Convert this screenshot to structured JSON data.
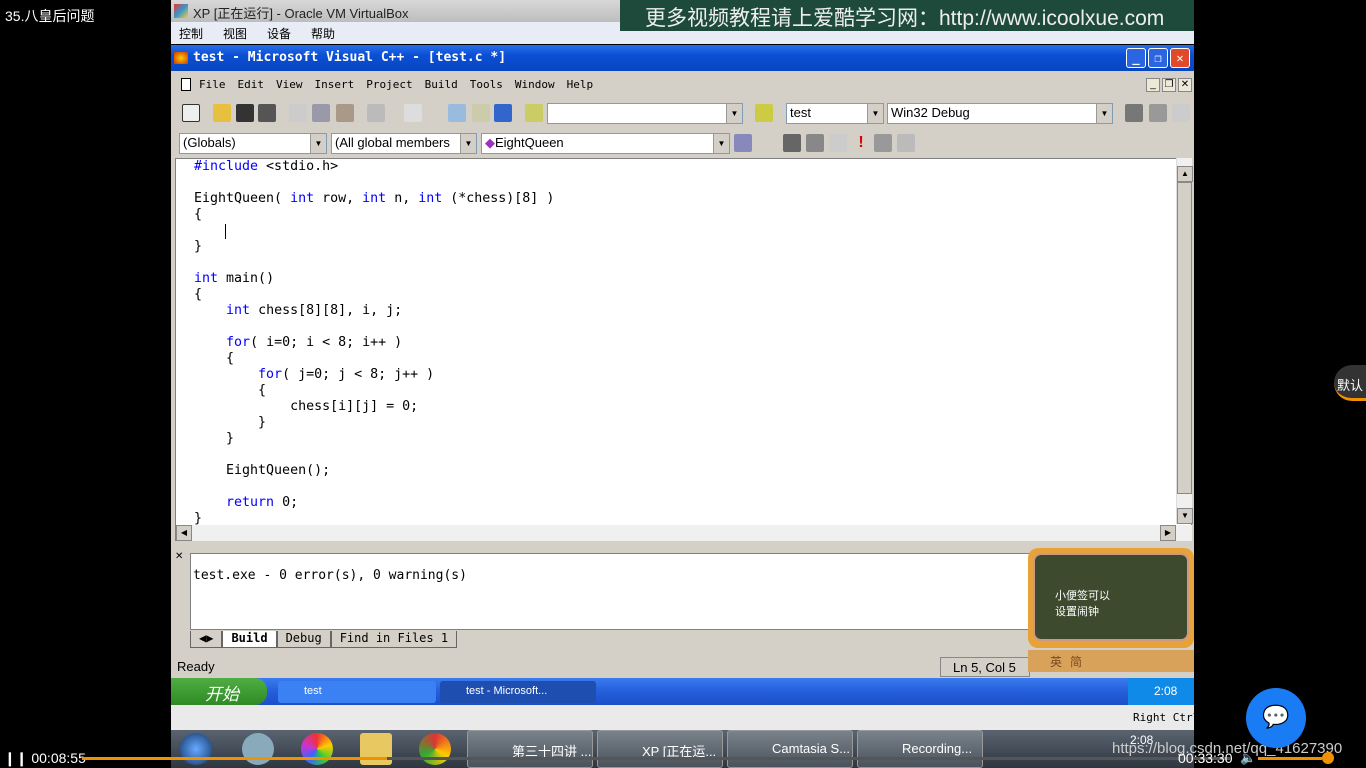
{
  "video": {
    "title": "35.八皇后问题",
    "current_time": "00:08:55",
    "total_time": "00:33:30",
    "progress": 0.266,
    "volume": 0.8,
    "url_watermark": "https://blog.csdn.net/qq_41627390",
    "default_label": "默认",
    "accent": "#f29100"
  },
  "vbox": {
    "title": "XP [正在运行] - Oracle VM VirtualBox",
    "menu": [
      "控制",
      "视图",
      "设备",
      "帮助"
    ],
    "right_ctrl": "Right Ctrl"
  },
  "watermark": "更多视频教程请上爱酷学习网：http://www.icoolxue.com",
  "vc": {
    "title": "test - Microsoft Visual C++ - [test.c *]",
    "menu": [
      "File",
      "Edit",
      "View",
      "Insert",
      "Project",
      "Build",
      "Tools",
      "Window",
      "Help"
    ],
    "toolbar": {
      "find_value": "",
      "project": "test",
      "config": "Win32 Debug"
    },
    "wizard": {
      "scope": "(Globals)",
      "members": "(All global members",
      "function": "EightQueen"
    },
    "code": [
      [
        [
          "#include",
          "kw"
        ],
        [
          " <stdio.h>",
          ""
        ]
      ],
      [],
      [
        [
          "EightQueen( ",
          ""
        ],
        [
          "int",
          "kw"
        ],
        [
          " row, ",
          ""
        ],
        [
          "int",
          "kw"
        ],
        [
          " n, ",
          ""
        ],
        [
          "int",
          "kw"
        ],
        [
          " (*chess)[8] )",
          ""
        ]
      ],
      [
        [
          "{",
          ""
        ]
      ],
      [],
      [
        [
          "}",
          ""
        ]
      ],
      [],
      [
        [
          "int",
          "kw"
        ],
        [
          " main()",
          ""
        ]
      ],
      [
        [
          "{",
          ""
        ]
      ],
      [
        [
          "    ",
          ""
        ],
        [
          "int",
          "kw"
        ],
        [
          " chess[8][8], i, j;",
          ""
        ]
      ],
      [],
      [
        [
          "    ",
          ""
        ],
        [
          "for",
          "kw"
        ],
        [
          "( i=0; i < 8; i++ )",
          ""
        ]
      ],
      [
        [
          "    {",
          ""
        ]
      ],
      [
        [
          "        ",
          ""
        ],
        [
          "for",
          "kw"
        ],
        [
          "( j=0; j < 8; j++ )",
          ""
        ]
      ],
      [
        [
          "        {",
          ""
        ]
      ],
      [
        [
          "            chess[i][j] = 0;",
          ""
        ]
      ],
      [
        [
          "        }",
          ""
        ]
      ],
      [
        [
          "    }",
          ""
        ]
      ],
      [],
      [
        [
          "    EightQueen();",
          ""
        ]
      ],
      [],
      [
        [
          "    ",
          ""
        ],
        [
          "return",
          "kw"
        ],
        [
          " 0;",
          ""
        ]
      ],
      [
        [
          "}",
          ""
        ]
      ]
    ],
    "output": "test.exe - 0 error(s), 0 warning(s)",
    "output_tabs": [
      "Build",
      "Debug",
      "Find in Files 1"
    ],
    "status": "Ready",
    "position": "Ln 5, Col 5"
  },
  "sogou": {
    "note": "小便签可以\n设置闹钟",
    "bar": "英简"
  },
  "xp": {
    "start": "开始",
    "tasks": [
      "test",
      "test - Microsoft..."
    ],
    "clock": "2:08"
  },
  "win7": {
    "tasks": [
      "第三十四讲 ...",
      "XP [正在运...",
      "Camtasia S...",
      "Recording..."
    ],
    "clock": "2:08"
  }
}
